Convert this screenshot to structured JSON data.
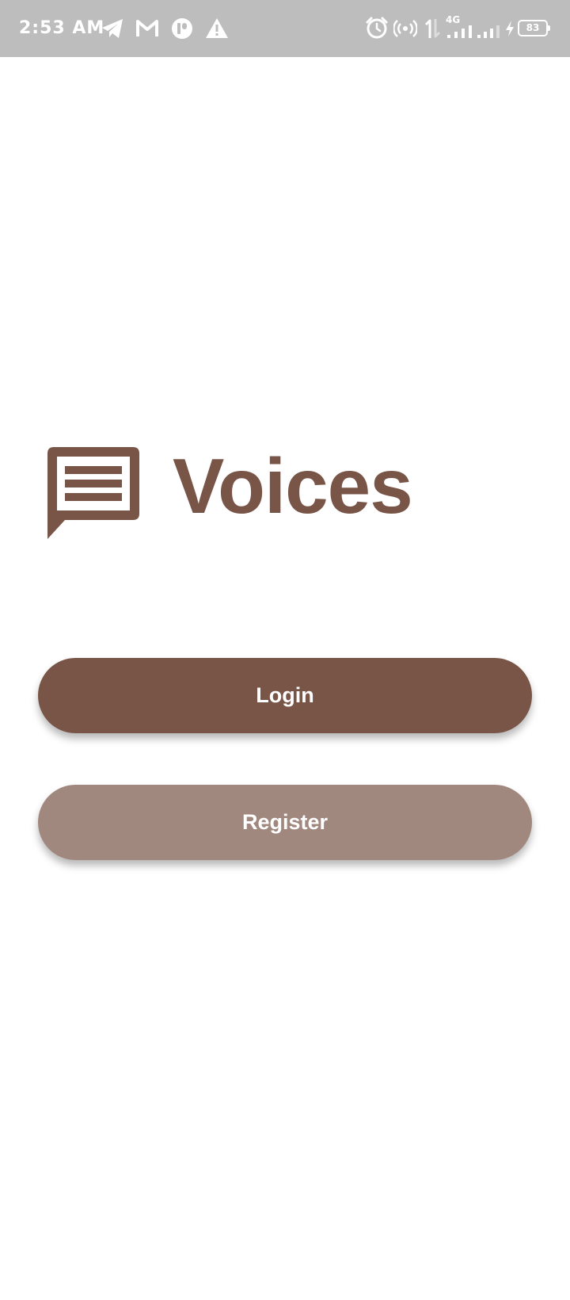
{
  "status_bar": {
    "time": "2:53 AM",
    "network_type": "4G",
    "battery_level": "83",
    "notification_icons": [
      "telegram-icon",
      "gmail-icon",
      "app-notification-icon",
      "warning-icon"
    ],
    "system_icons": [
      "alarm-icon",
      "hotspot-icon",
      "data-activity-icon",
      "signal-icon",
      "signal-icon",
      "charging-icon",
      "battery-icon"
    ],
    "background_color": "#bdbdbd"
  },
  "brand": {
    "title": "Voices",
    "icon": "chat-bubble-icon",
    "color": "#795548"
  },
  "actions": {
    "login_label": "Login",
    "register_label": "Register",
    "login_color": "#795548",
    "register_color": "#a1887f"
  }
}
